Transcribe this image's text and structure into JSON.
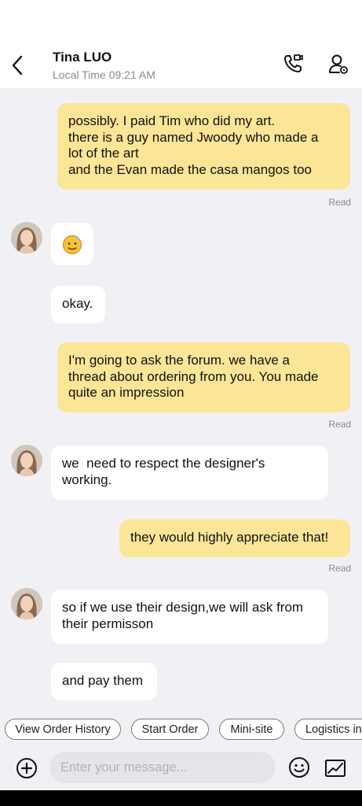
{
  "header": {
    "contact_name": "Tina LUO",
    "local_time_label": "Local Time",
    "local_time_value": "09:21 AM"
  },
  "messages": [
    {
      "direction": "out",
      "lines": [
        "possibly. I paid Tim who did my art.",
        "there is a guy named Jwoody who made a",
        "lot of the art",
        "and the Evan made the casa mangos too"
      ],
      "status": "Read"
    },
    {
      "direction": "in",
      "emoji": "sweat-smile-emoji"
    },
    {
      "direction": "in",
      "lines": [
        "okay."
      ]
    },
    {
      "direction": "out",
      "lines": [
        "I'm going to ask the forum. we have a",
        "thread about ordering from you. You made",
        "quite an impression"
      ],
      "status": "Read"
    },
    {
      "direction": "in",
      "lines": [
        "we  need to respect the designer's",
        "working."
      ]
    },
    {
      "direction": "out",
      "lines": [
        "they would highly appreciate that!"
      ],
      "status": "Read"
    },
    {
      "direction": "in",
      "lines": [
        "so if we use their design,we will ask from",
        "their permisson"
      ]
    },
    {
      "direction": "in",
      "lines": [
        "and pay them"
      ]
    }
  ],
  "quick_actions": [
    "View Order History",
    "Start Order",
    "Mini-site",
    "Logistics in"
  ],
  "composer": {
    "placeholder": "Enter your message...",
    "icons": {
      "add": "plus-circle-icon",
      "emoji": "smiley-icon",
      "image": "image-icon"
    }
  },
  "colors": {
    "outgoing_bubble": "#fbe597",
    "incoming_bubble": "#ffffff",
    "background": "#f1f1f5",
    "read_text": "#8a8a8a"
  }
}
